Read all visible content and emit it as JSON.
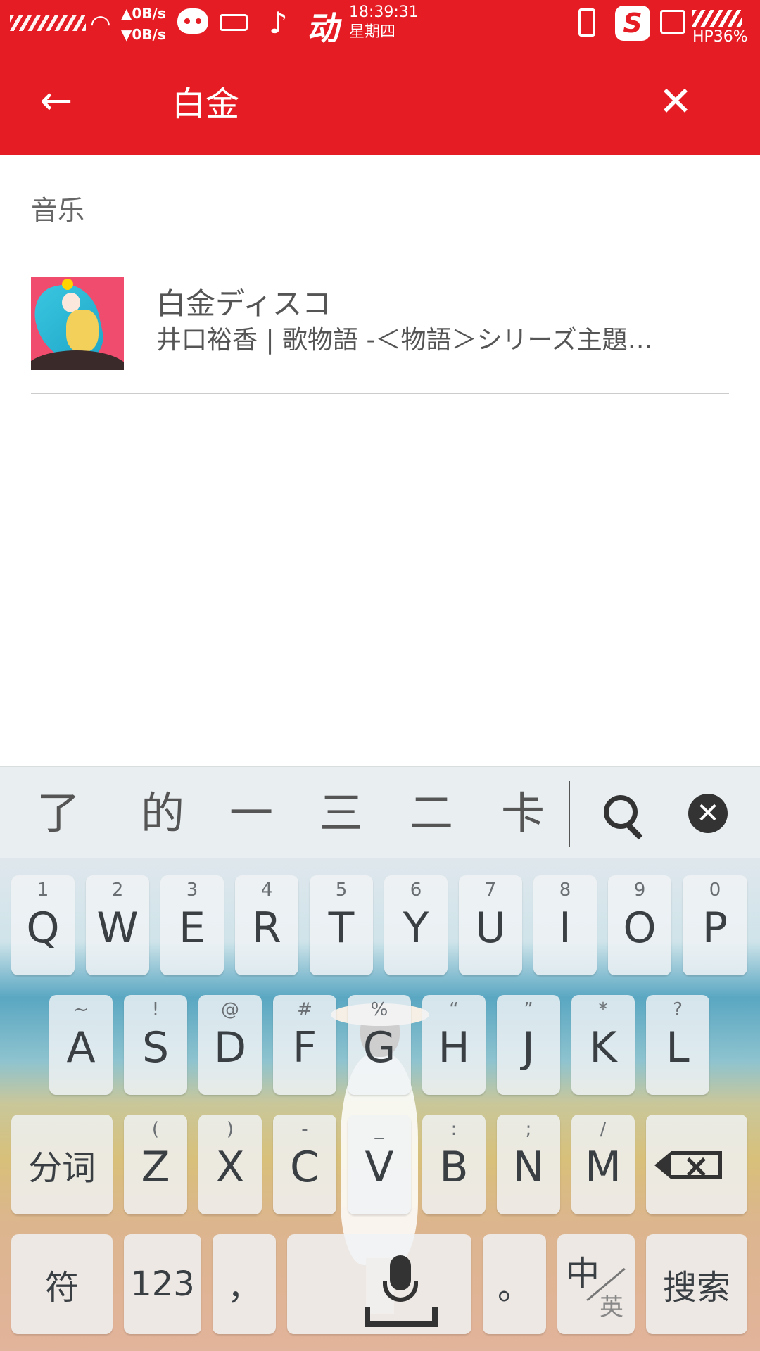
{
  "status_bar": {
    "speed_up": "▲0B/s",
    "speed_down": "▼0B/s",
    "time": "18:39:31",
    "weekday": "星期四",
    "battery": "HP36%",
    "icons": [
      "signal-icon",
      "wifi-icon",
      "cat-face-icon",
      "keyboard-icon",
      "music-note-icon",
      "dong-icon",
      "phone-icon",
      "sogou-icon",
      "gallery-icon",
      "battery-icon"
    ]
  },
  "toolbar": {
    "query": "白金",
    "back_icon": "arrow-left-icon",
    "close_icon": "close-icon",
    "color": "#e51c23"
  },
  "results": {
    "section_label": "音乐",
    "items": [
      {
        "title": "白金ディスコ",
        "subtitle": "井口裕香 | 歌物語 -＜物語＞シリーズ主題…"
      }
    ]
  },
  "keyboard": {
    "candidates": [
      "了",
      "的",
      "一",
      "三",
      "二",
      "卡"
    ],
    "row1": [
      {
        "hint": "1",
        "key": "Q"
      },
      {
        "hint": "2",
        "key": "W"
      },
      {
        "hint": "3",
        "key": "E"
      },
      {
        "hint": "4",
        "key": "R"
      },
      {
        "hint": "5",
        "key": "T"
      },
      {
        "hint": "6",
        "key": "Y"
      },
      {
        "hint": "7",
        "key": "U"
      },
      {
        "hint": "8",
        "key": "I"
      },
      {
        "hint": "9",
        "key": "O"
      },
      {
        "hint": "0",
        "key": "P"
      }
    ],
    "row2": [
      {
        "hint": "~",
        "key": "A"
      },
      {
        "hint": "!",
        "key": "S"
      },
      {
        "hint": "@",
        "key": "D"
      },
      {
        "hint": "#",
        "key": "F"
      },
      {
        "hint": "%",
        "key": "G"
      },
      {
        "hint": "“",
        "key": "H"
      },
      {
        "hint": "”",
        "key": "J"
      },
      {
        "hint": "*",
        "key": "K"
      },
      {
        "hint": "?",
        "key": "L"
      }
    ],
    "row3": [
      {
        "hint": "(",
        "key": "Z"
      },
      {
        "hint": ")",
        "key": "X"
      },
      {
        "hint": "-",
        "key": "C"
      },
      {
        "hint": "_",
        "key": "V"
      },
      {
        "hint": ":",
        "key": "B"
      },
      {
        "hint": ";",
        "key": "N"
      },
      {
        "hint": "/",
        "key": "M"
      }
    ],
    "segment_label": "分词",
    "symbol_label": "符",
    "numbers_label": "123",
    "comma_label": "，",
    "period_label": "。",
    "lang_zh": "中",
    "lang_en": "英",
    "search_label": "搜索"
  }
}
